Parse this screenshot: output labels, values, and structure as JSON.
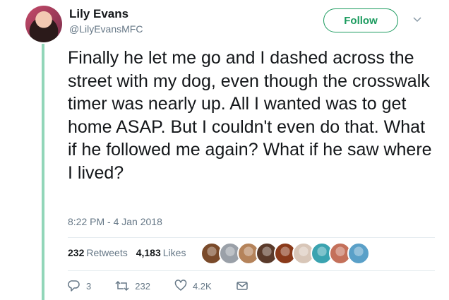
{
  "user": {
    "name": "Lily Evans",
    "handle": "@LilyEvansMFC"
  },
  "follow_label": "Follow",
  "tweet": {
    "text": "Finally he let me go and I dashed across the street with my dog, even though the crosswalk timer was nearly up. All I wanted was to get home ASAP. But I couldn't even do that. What if he followed me again? What if he saw where I lived?",
    "timestamp": "8:22 PM - 4 Jan 2018"
  },
  "stats": {
    "retweets_count": "232",
    "retweets_label": "Retweets",
    "likes_count": "4,183",
    "likes_label": "Likes"
  },
  "liker_avatars": [
    {
      "color": "#7a4a2a"
    },
    {
      "color": "#9aa0a8"
    },
    {
      "color": "#b5835a"
    },
    {
      "color": "#5a3a2a"
    },
    {
      "color": "#8a3a1a"
    },
    {
      "color": "#d8c6b8"
    },
    {
      "color": "#3aa3b0"
    },
    {
      "color": "#c4705a"
    },
    {
      "color": "#5aa0c8"
    }
  ],
  "actions": {
    "replies": "3",
    "retweets": "232",
    "likes": "4.2K"
  },
  "colors": {
    "thread_line": "#92d6b9",
    "follow_accent": "#1c9b5f",
    "muted": "#657786"
  }
}
